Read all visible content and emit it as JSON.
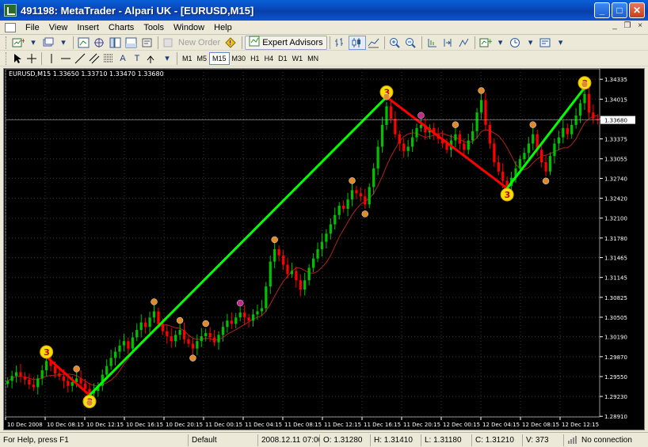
{
  "window": {
    "title": "491198: MetaTrader - Alpari UK - [EURUSD,M15]",
    "min_label": "_",
    "max_label": "□",
    "close_label": "✕"
  },
  "menu": {
    "items": [
      "File",
      "View",
      "Insert",
      "Charts",
      "Tools",
      "Window",
      "Help"
    ],
    "mdi_min": "_",
    "mdi_restore": "❐",
    "mdi_close": "×"
  },
  "toolbar": {
    "new_order_label": "New Order",
    "expert_advisors_label": "Expert Advisors",
    "timeframes": [
      "M1",
      "M5",
      "M15",
      "M30",
      "H1",
      "H4",
      "D1",
      "W1",
      "MN"
    ],
    "selected_timeframe": "M15",
    "text_tool_label": "A",
    "text_label_tool": "T"
  },
  "chart": {
    "symbol_info": "EURUSD,M15  1.33650 1.33710 1.33470 1.33680",
    "current_price_label": "1.33680",
    "zigzag_label": "3",
    "colors": {
      "background": "#000000",
      "bull": "#00c000",
      "bear": "#ff0000",
      "zigzag_up": "#00ff00",
      "zigzag_down": "#ff0000",
      "ma": "#b22222",
      "marker_orange": "#e08a2a",
      "marker_magenta": "#c02a8a",
      "marker_yellow": "#f5e000"
    }
  },
  "chart_data": {
    "type": "candlestick",
    "ylim": [
      1.289,
      1.3435
    ],
    "yticks": [
      1.34335,
      1.34015,
      1.33695,
      1.33375,
      1.33055,
      1.3274,
      1.3242,
      1.321,
      1.3178,
      1.31465,
      1.31145,
      1.30825,
      1.30505,
      1.3019,
      1.2987,
      1.2955,
      1.2923,
      1.2891
    ],
    "ytick_labels": [
      "1.34335",
      "1.34015",
      "1.33695",
      "1.33375",
      "1.33055",
      "1.32740",
      "1.32420",
      "1.32100",
      "1.31780",
      "1.31465",
      "1.31145",
      "1.30825",
      "1.30505",
      "1.30190",
      "1.29870",
      "1.29550",
      "1.29230",
      "1.28910"
    ],
    "xtick_labels": [
      "10 Dec 2008",
      "10 Dec 08:15",
      "10 Dec 12:15",
      "10 Dec 16:15",
      "10 Dec 20:15",
      "11 Dec 00:15",
      "11 Dec 04:15",
      "11 Dec 08:15",
      "11 Dec 12:15",
      "11 Dec 16:15",
      "11 Dec 20:15",
      "12 Dec 00:15",
      "12 Dec 04:15",
      "12 Dec 08:15",
      "12 Dec 12:15"
    ],
    "zigzag": [
      {
        "i": 9,
        "price": 1.2987,
        "label": "3"
      },
      {
        "i": 19,
        "price": 1.2925,
        "label": "3"
      },
      {
        "i": 88,
        "price": 1.3405,
        "label": "3"
      },
      {
        "i": 116,
        "price": 1.3258,
        "label": "3"
      },
      {
        "i": 134,
        "price": 1.342,
        "label": "3"
      }
    ],
    "close": [
      1.2948,
      1.2956,
      1.2962,
      1.2955,
      1.295,
      1.2942,
      1.2938,
      1.2952,
      1.2965,
      1.298,
      1.2972,
      1.296,
      1.2955,
      1.2948,
      1.294,
      1.2946,
      1.2952,
      1.2944,
      1.2935,
      1.2928,
      1.2932,
      1.294,
      1.2958,
      1.2972,
      1.2985,
      1.2995,
      1.3005,
      1.3012,
      1.3,
      1.3018,
      1.303,
      1.3042,
      1.3035,
      1.305,
      1.306,
      1.304,
      1.3028,
      1.302,
      1.3012,
      1.3022,
      1.303,
      1.3015,
      1.3008,
      1.3,
      1.3012,
      1.302,
      1.3025,
      1.3018,
      1.301,
      1.3022,
      1.3035,
      1.3045,
      1.304,
      1.305,
      1.3058,
      1.305,
      1.3045,
      1.3055,
      1.306,
      1.3065,
      1.31,
      1.314,
      1.316,
      1.315,
      1.3135,
      1.312,
      1.3125,
      1.311,
      1.3095,
      1.311,
      1.313,
      1.3145,
      1.316,
      1.3172,
      1.3185,
      1.32,
      1.3215,
      1.323,
      1.3225,
      1.324,
      1.3255,
      1.325,
      1.3245,
      1.3232,
      1.326,
      1.329,
      1.3325,
      1.336,
      1.339,
      1.337,
      1.3345,
      1.333,
      1.3318,
      1.3325,
      1.334,
      1.3355,
      1.336,
      1.3348,
      1.3355,
      1.3345,
      1.3338,
      1.333,
      1.332,
      1.3335,
      1.3345,
      1.333,
      1.332,
      1.3335,
      1.335,
      1.338,
      1.34,
      1.336,
      1.333,
      1.33,
      1.3285,
      1.327,
      1.3262,
      1.3275,
      1.329,
      1.3305,
      1.3315,
      1.333,
      1.3345,
      1.332,
      1.33,
      1.3285,
      1.331,
      1.333,
      1.334,
      1.3355,
      1.3345,
      1.336,
      1.3375,
      1.3395,
      1.341,
      1.338,
      1.337,
      1.3368
    ]
  },
  "status": {
    "help": "For Help, press F1",
    "profile": "Default",
    "datetime": "2008.12.11 07:00",
    "open": "O: 1.31280",
    "high": "H: 1.31410",
    "low": "L: 1.31180",
    "close": "C: 1.31210",
    "volume": "V: 373",
    "connection": "No connection"
  }
}
